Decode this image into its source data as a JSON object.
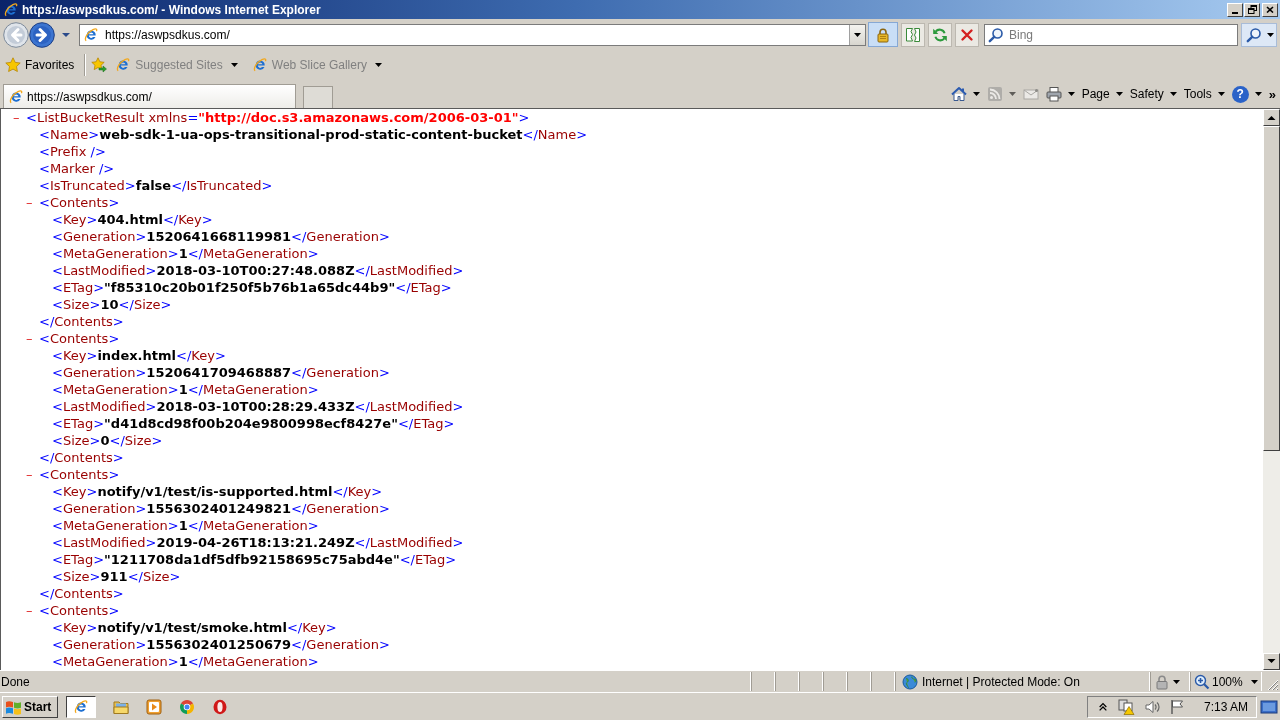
{
  "window": {
    "title": "https://aswpsdkus.com/ - Windows Internet Explorer"
  },
  "address_bar": {
    "url": "https://aswpsdkus.com/",
    "secure": true
  },
  "search": {
    "placeholder": "Bing"
  },
  "favorites_bar": {
    "label": "Favorites",
    "items": [
      {
        "label": "Suggested Sites",
        "disabled": true
      },
      {
        "label": "Web Slice Gallery",
        "disabled": true
      }
    ]
  },
  "tabs": [
    {
      "label": "https://aswpsdkus.com/",
      "selected": true
    }
  ],
  "command_bar": [
    {
      "kind": "home",
      "disabled": false
    },
    {
      "kind": "feeds",
      "disabled": true
    },
    {
      "kind": "mail",
      "disabled": true
    },
    {
      "kind": "print",
      "disabled": false
    },
    {
      "kind": "menu",
      "label": "Page",
      "disabled": false
    },
    {
      "kind": "menu",
      "label": "Safety",
      "disabled": false
    },
    {
      "kind": "menu",
      "label": "Tools",
      "disabled": false
    },
    {
      "kind": "help",
      "label": "?",
      "disabled": false
    },
    {
      "kind": "overflow",
      "label": "»",
      "disabled": false
    }
  ],
  "document": {
    "nodes": [
      {
        "toggle": "–",
        "expanded": true,
        "open": [
          {
            "kind": "mark",
            "text": "<"
          },
          {
            "kind": "tag",
            "text": "ListBucketResult"
          },
          {
            "kind": "attr",
            "text": " xmlns"
          },
          {
            "kind": "mark",
            "text": "="
          },
          {
            "kind": "value",
            "text": "\"http://doc.s3.amazonaws.com/2006-03-01\""
          },
          {
            "kind": "mark",
            "text": ">"
          }
        ],
        "children": [
          {
            "parts": [
              {
                "kind": "mark",
                "text": "<"
              },
              {
                "kind": "tag",
                "text": "Name"
              },
              {
                "kind": "mark",
                "text": ">"
              },
              {
                "kind": "content",
                "text": "web-sdk-1-ua-ops-transitional-prod-static-content-bucket"
              },
              {
                "kind": "mark",
                "text": "</"
              },
              {
                "kind": "tag",
                "text": "Name"
              },
              {
                "kind": "mark",
                "text": ">"
              }
            ]
          },
          {
            "parts": [
              {
                "kind": "mark",
                "text": "<"
              },
              {
                "kind": "tag",
                "text": "Prefix"
              },
              {
                "kind": "mark",
                "text": " />"
              }
            ]
          },
          {
            "parts": [
              {
                "kind": "mark",
                "text": "<"
              },
              {
                "kind": "tag",
                "text": "Marker"
              },
              {
                "kind": "mark",
                "text": " />"
              }
            ]
          },
          {
            "parts": [
              {
                "kind": "mark",
                "text": "<"
              },
              {
                "kind": "tag",
                "text": "IsTruncated"
              },
              {
                "kind": "mark",
                "text": ">"
              },
              {
                "kind": "content",
                "text": "false"
              },
              {
                "kind": "mark",
                "text": "</"
              },
              {
                "kind": "tag",
                "text": "IsTruncated"
              },
              {
                "kind": "mark",
                "text": ">"
              }
            ]
          },
          {
            "toggle": "–",
            "expanded": true,
            "open": [
              {
                "kind": "mark",
                "text": "<"
              },
              {
                "kind": "tag",
                "text": "Contents"
              },
              {
                "kind": "mark",
                "text": ">"
              }
            ],
            "children": [
              {
                "parts": [
                  {
                    "kind": "mark",
                    "text": "<"
                  },
                  {
                    "kind": "tag",
                    "text": "Key"
                  },
                  {
                    "kind": "mark",
                    "text": ">"
                  },
                  {
                    "kind": "content",
                    "text": "404.html"
                  },
                  {
                    "kind": "mark",
                    "text": "</"
                  },
                  {
                    "kind": "tag",
                    "text": "Key"
                  },
                  {
                    "kind": "mark",
                    "text": ">"
                  }
                ]
              },
              {
                "parts": [
                  {
                    "kind": "mark",
                    "text": "<"
                  },
                  {
                    "kind": "tag",
                    "text": "Generation"
                  },
                  {
                    "kind": "mark",
                    "text": ">"
                  },
                  {
                    "kind": "content",
                    "text": "1520641668119981"
                  },
                  {
                    "kind": "mark",
                    "text": "</"
                  },
                  {
                    "kind": "tag",
                    "text": "Generation"
                  },
                  {
                    "kind": "mark",
                    "text": ">"
                  }
                ]
              },
              {
                "parts": [
                  {
                    "kind": "mark",
                    "text": "<"
                  },
                  {
                    "kind": "tag",
                    "text": "MetaGeneration"
                  },
                  {
                    "kind": "mark",
                    "text": ">"
                  },
                  {
                    "kind": "content",
                    "text": "1"
                  },
                  {
                    "kind": "mark",
                    "text": "</"
                  },
                  {
                    "kind": "tag",
                    "text": "MetaGeneration"
                  },
                  {
                    "kind": "mark",
                    "text": ">"
                  }
                ]
              },
              {
                "parts": [
                  {
                    "kind": "mark",
                    "text": "<"
                  },
                  {
                    "kind": "tag",
                    "text": "LastModified"
                  },
                  {
                    "kind": "mark",
                    "text": ">"
                  },
                  {
                    "kind": "content",
                    "text": "2018-03-10T00:27:48.088Z"
                  },
                  {
                    "kind": "mark",
                    "text": "</"
                  },
                  {
                    "kind": "tag",
                    "text": "LastModified"
                  },
                  {
                    "kind": "mark",
                    "text": ">"
                  }
                ]
              },
              {
                "parts": [
                  {
                    "kind": "mark",
                    "text": "<"
                  },
                  {
                    "kind": "tag",
                    "text": "ETag"
                  },
                  {
                    "kind": "mark",
                    "text": ">"
                  },
                  {
                    "kind": "content",
                    "text": "\"f85310c20b01f250f5b76b1a65dc44b9\""
                  },
                  {
                    "kind": "mark",
                    "text": "</"
                  },
                  {
                    "kind": "tag",
                    "text": "ETag"
                  },
                  {
                    "kind": "mark",
                    "text": ">"
                  }
                ]
              },
              {
                "parts": [
                  {
                    "kind": "mark",
                    "text": "<"
                  },
                  {
                    "kind": "tag",
                    "text": "Size"
                  },
                  {
                    "kind": "mark",
                    "text": ">"
                  },
                  {
                    "kind": "content",
                    "text": "10"
                  },
                  {
                    "kind": "mark",
                    "text": "</"
                  },
                  {
                    "kind": "tag",
                    "text": "Size"
                  },
                  {
                    "kind": "mark",
                    "text": ">"
                  }
                ]
              }
            ],
            "close": [
              {
                "kind": "mark",
                "text": "</"
              },
              {
                "kind": "tag",
                "text": "Contents"
              },
              {
                "kind": "mark",
                "text": ">"
              }
            ]
          },
          {
            "toggle": "–",
            "expanded": true,
            "open": [
              {
                "kind": "mark",
                "text": "<"
              },
              {
                "kind": "tag",
                "text": "Contents"
              },
              {
                "kind": "mark",
                "text": ">"
              }
            ],
            "children": [
              {
                "parts": [
                  {
                    "kind": "mark",
                    "text": "<"
                  },
                  {
                    "kind": "tag",
                    "text": "Key"
                  },
                  {
                    "kind": "mark",
                    "text": ">"
                  },
                  {
                    "kind": "content",
                    "text": "index.html"
                  },
                  {
                    "kind": "mark",
                    "text": "</"
                  },
                  {
                    "kind": "tag",
                    "text": "Key"
                  },
                  {
                    "kind": "mark",
                    "text": ">"
                  }
                ]
              },
              {
                "parts": [
                  {
                    "kind": "mark",
                    "text": "<"
                  },
                  {
                    "kind": "tag",
                    "text": "Generation"
                  },
                  {
                    "kind": "mark",
                    "text": ">"
                  },
                  {
                    "kind": "content",
                    "text": "1520641709468887"
                  },
                  {
                    "kind": "mark",
                    "text": "</"
                  },
                  {
                    "kind": "tag",
                    "text": "Generation"
                  },
                  {
                    "kind": "mark",
                    "text": ">"
                  }
                ]
              },
              {
                "parts": [
                  {
                    "kind": "mark",
                    "text": "<"
                  },
                  {
                    "kind": "tag",
                    "text": "MetaGeneration"
                  },
                  {
                    "kind": "mark",
                    "text": ">"
                  },
                  {
                    "kind": "content",
                    "text": "1"
                  },
                  {
                    "kind": "mark",
                    "text": "</"
                  },
                  {
                    "kind": "tag",
                    "text": "MetaGeneration"
                  },
                  {
                    "kind": "mark",
                    "text": ">"
                  }
                ]
              },
              {
                "parts": [
                  {
                    "kind": "mark",
                    "text": "<"
                  },
                  {
                    "kind": "tag",
                    "text": "LastModified"
                  },
                  {
                    "kind": "mark",
                    "text": ">"
                  },
                  {
                    "kind": "content",
                    "text": "2018-03-10T00:28:29.433Z"
                  },
                  {
                    "kind": "mark",
                    "text": "</"
                  },
                  {
                    "kind": "tag",
                    "text": "LastModified"
                  },
                  {
                    "kind": "mark",
                    "text": ">"
                  }
                ]
              },
              {
                "parts": [
                  {
                    "kind": "mark",
                    "text": "<"
                  },
                  {
                    "kind": "tag",
                    "text": "ETag"
                  },
                  {
                    "kind": "mark",
                    "text": ">"
                  },
                  {
                    "kind": "content",
                    "text": "\"d41d8cd98f00b204e9800998ecf8427e\""
                  },
                  {
                    "kind": "mark",
                    "text": "</"
                  },
                  {
                    "kind": "tag",
                    "text": "ETag"
                  },
                  {
                    "kind": "mark",
                    "text": ">"
                  }
                ]
              },
              {
                "parts": [
                  {
                    "kind": "mark",
                    "text": "<"
                  },
                  {
                    "kind": "tag",
                    "text": "Size"
                  },
                  {
                    "kind": "mark",
                    "text": ">"
                  },
                  {
                    "kind": "content",
                    "text": "0"
                  },
                  {
                    "kind": "mark",
                    "text": "</"
                  },
                  {
                    "kind": "tag",
                    "text": "Size"
                  },
                  {
                    "kind": "mark",
                    "text": ">"
                  }
                ]
              }
            ],
            "close": [
              {
                "kind": "mark",
                "text": "</"
              },
              {
                "kind": "tag",
                "text": "Contents"
              },
              {
                "kind": "mark",
                "text": ">"
              }
            ]
          },
          {
            "toggle": "–",
            "expanded": true,
            "open": [
              {
                "kind": "mark",
                "text": "<"
              },
              {
                "kind": "tag",
                "text": "Contents"
              },
              {
                "kind": "mark",
                "text": ">"
              }
            ],
            "children": [
              {
                "parts": [
                  {
                    "kind": "mark",
                    "text": "<"
                  },
                  {
                    "kind": "tag",
                    "text": "Key"
                  },
                  {
                    "kind": "mark",
                    "text": ">"
                  },
                  {
                    "kind": "content",
                    "text": "notify/v1/test/is-supported.html"
                  },
                  {
                    "kind": "mark",
                    "text": "</"
                  },
                  {
                    "kind": "tag",
                    "text": "Key"
                  },
                  {
                    "kind": "mark",
                    "text": ">"
                  }
                ]
              },
              {
                "parts": [
                  {
                    "kind": "mark",
                    "text": "<"
                  },
                  {
                    "kind": "tag",
                    "text": "Generation"
                  },
                  {
                    "kind": "mark",
                    "text": ">"
                  },
                  {
                    "kind": "content",
                    "text": "1556302401249821"
                  },
                  {
                    "kind": "mark",
                    "text": "</"
                  },
                  {
                    "kind": "tag",
                    "text": "Generation"
                  },
                  {
                    "kind": "mark",
                    "text": ">"
                  }
                ]
              },
              {
                "parts": [
                  {
                    "kind": "mark",
                    "text": "<"
                  },
                  {
                    "kind": "tag",
                    "text": "MetaGeneration"
                  },
                  {
                    "kind": "mark",
                    "text": ">"
                  },
                  {
                    "kind": "content",
                    "text": "1"
                  },
                  {
                    "kind": "mark",
                    "text": "</"
                  },
                  {
                    "kind": "tag",
                    "text": "MetaGeneration"
                  },
                  {
                    "kind": "mark",
                    "text": ">"
                  }
                ]
              },
              {
                "parts": [
                  {
                    "kind": "mark",
                    "text": "<"
                  },
                  {
                    "kind": "tag",
                    "text": "LastModified"
                  },
                  {
                    "kind": "mark",
                    "text": ">"
                  },
                  {
                    "kind": "content",
                    "text": "2019-04-26T18:13:21.249Z"
                  },
                  {
                    "kind": "mark",
                    "text": "</"
                  },
                  {
                    "kind": "tag",
                    "text": "LastModified"
                  },
                  {
                    "kind": "mark",
                    "text": ">"
                  }
                ]
              },
              {
                "parts": [
                  {
                    "kind": "mark",
                    "text": "<"
                  },
                  {
                    "kind": "tag",
                    "text": "ETag"
                  },
                  {
                    "kind": "mark",
                    "text": ">"
                  },
                  {
                    "kind": "content",
                    "text": "\"1211708da1df5dfb92158695c75abd4e\""
                  },
                  {
                    "kind": "mark",
                    "text": "</"
                  },
                  {
                    "kind": "tag",
                    "text": "ETag"
                  },
                  {
                    "kind": "mark",
                    "text": ">"
                  }
                ]
              },
              {
                "parts": [
                  {
                    "kind": "mark",
                    "text": "<"
                  },
                  {
                    "kind": "tag",
                    "text": "Size"
                  },
                  {
                    "kind": "mark",
                    "text": ">"
                  },
                  {
                    "kind": "content",
                    "text": "911"
                  },
                  {
                    "kind": "mark",
                    "text": "</"
                  },
                  {
                    "kind": "tag",
                    "text": "Size"
                  },
                  {
                    "kind": "mark",
                    "text": ">"
                  }
                ]
              }
            ],
            "close": [
              {
                "kind": "mark",
                "text": "</"
              },
              {
                "kind": "tag",
                "text": "Contents"
              },
              {
                "kind": "mark",
                "text": ">"
              }
            ]
          },
          {
            "toggle": "–",
            "expanded": true,
            "open": [
              {
                "kind": "mark",
                "text": "<"
              },
              {
                "kind": "tag",
                "text": "Contents"
              },
              {
                "kind": "mark",
                "text": ">"
              }
            ],
            "children": [
              {
                "parts": [
                  {
                    "kind": "mark",
                    "text": "<"
                  },
                  {
                    "kind": "tag",
                    "text": "Key"
                  },
                  {
                    "kind": "mark",
                    "text": ">"
                  },
                  {
                    "kind": "content",
                    "text": "notify/v1/test/smoke.html"
                  },
                  {
                    "kind": "mark",
                    "text": "</"
                  },
                  {
                    "kind": "tag",
                    "text": "Key"
                  },
                  {
                    "kind": "mark",
                    "text": ">"
                  }
                ]
              },
              {
                "parts": [
                  {
                    "kind": "mark",
                    "text": "<"
                  },
                  {
                    "kind": "tag",
                    "text": "Generation"
                  },
                  {
                    "kind": "mark",
                    "text": ">"
                  },
                  {
                    "kind": "content",
                    "text": "1556302401250679"
                  },
                  {
                    "kind": "mark",
                    "text": "</"
                  },
                  {
                    "kind": "tag",
                    "text": "Generation"
                  },
                  {
                    "kind": "mark",
                    "text": ">"
                  }
                ]
              },
              {
                "parts": [
                  {
                    "kind": "mark",
                    "text": "<"
                  },
                  {
                    "kind": "tag",
                    "text": "MetaGeneration"
                  },
                  {
                    "kind": "mark",
                    "text": ">"
                  },
                  {
                    "kind": "content",
                    "text": "1"
                  },
                  {
                    "kind": "mark",
                    "text": "</"
                  },
                  {
                    "kind": "tag",
                    "text": "MetaGeneration"
                  },
                  {
                    "kind": "mark",
                    "text": ">"
                  }
                ]
              }
            ]
          }
        ]
      }
    ]
  },
  "status_bar": {
    "text": "Done",
    "zone": "Internet | Protected Mode: On",
    "zoom": "100%"
  },
  "taskbar": {
    "start": "Start",
    "apps": [
      {
        "kind": "e-logo",
        "selected": true
      },
      {
        "kind": "folder",
        "selected": false
      },
      {
        "kind": "play",
        "selected": false
      },
      {
        "kind": "ring",
        "selected": false
      },
      {
        "kind": "oval",
        "selected": false
      }
    ],
    "clock": "7:13 AM"
  }
}
